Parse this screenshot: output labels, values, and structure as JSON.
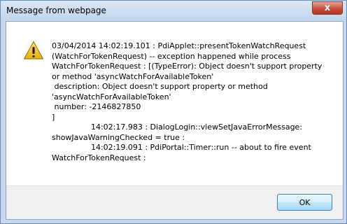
{
  "window": {
    "title": "Message from webpage",
    "close_glyph": "x"
  },
  "dialog": {
    "icon": "warning-icon",
    "message": "03/04/2014 14:02:19.101 : PdiApplet::presentTokenWatchRequest\n(WatchForTokenRequest) -- exception happened while process\nWatchForTokenRequest : [(TypeError): Object doesn't support property\nor method 'asyncWatchForAvailableToken'\n description: Object doesn't support property or method\n'asyncWatchForAvailableToken'\n number: -2146827850\n]\n                14:02:17.983 : DialogLogin::viewSetJavaErrorMessage:\nshowJavaWarningChecked = true :\n                14:02:19.091 : PdiPortal::Timer::run -- about to fire event\nWatchForTokenRequest :"
  },
  "buttons": {
    "ok_label": "OK"
  },
  "colors": {
    "title_bar": "#c9dbef",
    "close_button": "#c74c3c",
    "warning_fill": "#f2c21b",
    "ok_border": "#3c7fb1"
  }
}
